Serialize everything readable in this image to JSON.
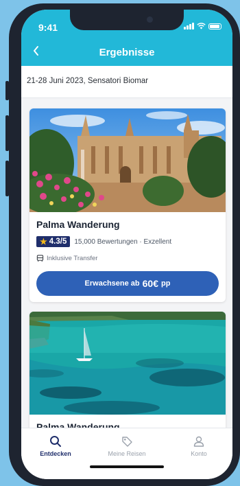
{
  "status": {
    "time": "9:41"
  },
  "header": {
    "title": "Ergebnisse",
    "back_icon": "chevron-left-icon"
  },
  "search_summary": "21-28 Juni 2023, Sensatori Biomar",
  "results": [
    {
      "title": "Palma Wanderung",
      "rating": "4.3/5",
      "reviews": "15,000 Bewertungen · Exzellent",
      "transfer": "Inklusive Transfer",
      "cta_prefix": "Erwachsene ab",
      "cta_price": "60€",
      "cta_suffix": "pp"
    },
    {
      "title": "Palma Wanderung"
    }
  ],
  "tabs": [
    {
      "label": "Entdecken",
      "icon": "search-icon",
      "active": true
    },
    {
      "label": "Meine Reisen",
      "icon": "tag-icon",
      "active": false
    },
    {
      "label": "Konto",
      "icon": "user-icon",
      "active": false
    }
  ],
  "colors": {
    "header": "#22b8d8",
    "primary_button": "#2e61b7",
    "rating_badge": "#1f2e6b",
    "background": "#7ec3e9"
  }
}
